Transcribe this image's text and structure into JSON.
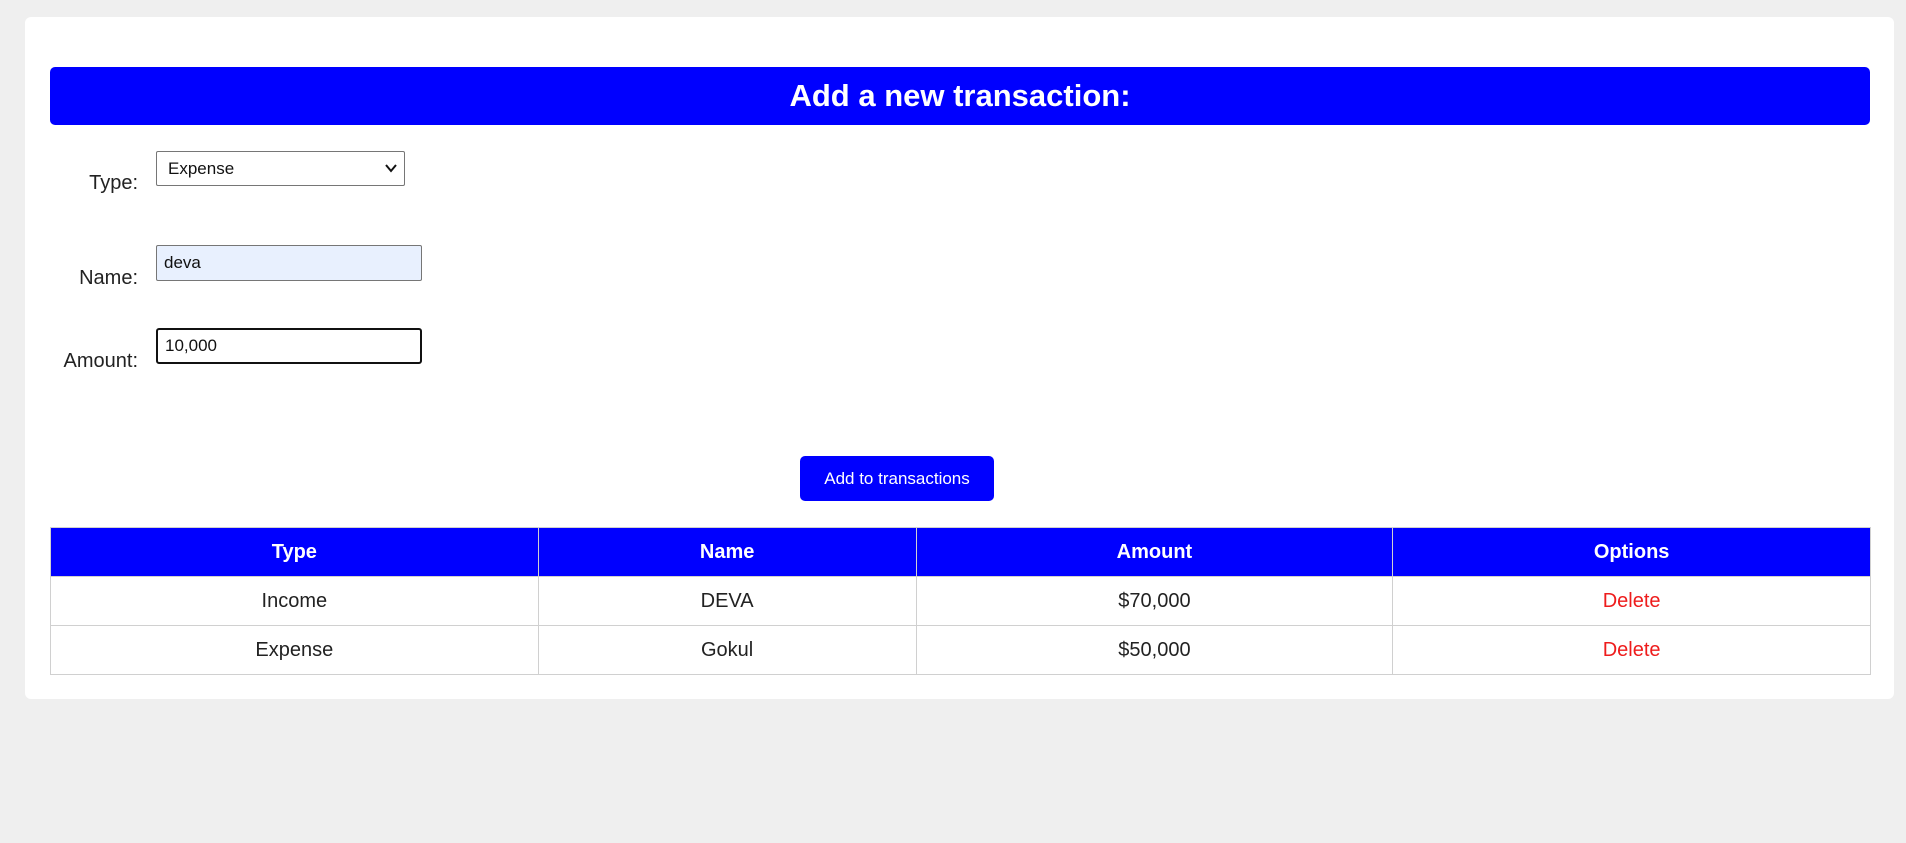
{
  "form": {
    "title": "Add a new transaction:",
    "type_label": "Type:",
    "type_selected": "Expense",
    "name_label": "Name:",
    "name_value": "deva",
    "amount_label": "Amount:",
    "amount_value": "10,000",
    "submit_label": "Add to transactions"
  },
  "table": {
    "headers": [
      "Type",
      "Name",
      "Amount",
      "Options"
    ],
    "rows": [
      {
        "type": "Income",
        "name": "DEVA",
        "amount": "$70,000",
        "option": "Delete"
      },
      {
        "type": "Expense",
        "name": "Gokul",
        "amount": "$50,000",
        "option": "Delete"
      }
    ]
  },
  "icons": {
    "select_arrow": "chevron-down-icon"
  },
  "colors": {
    "accent": "#0000ff",
    "delete": "#ee1c1c",
    "page_background": "#efefef",
    "autofill_background": "#e8f0fe"
  }
}
